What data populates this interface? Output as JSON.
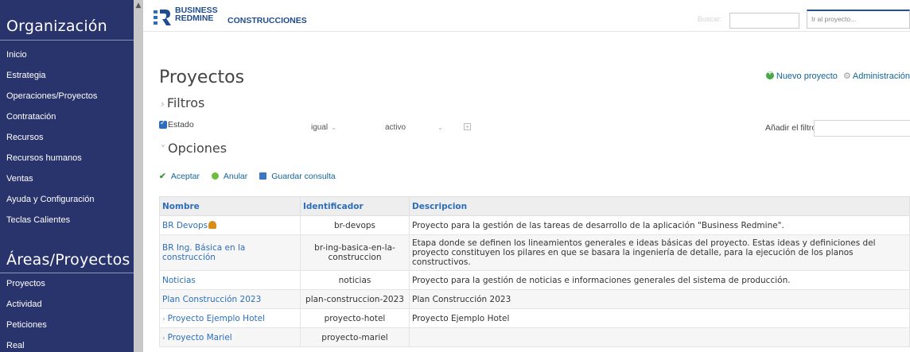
{
  "sidebar": {
    "sections": [
      "Organización",
      "Áreas/Proyectos"
    ],
    "org_items": [
      "Inicio",
      "Estrategia",
      "Operaciones/Proyectos",
      "Contratación",
      "Recursos",
      "Recursos humanos",
      "Ventas",
      "Ayuda y Configuración",
      "Teclas Calientes"
    ],
    "area_items": [
      "Proyectos",
      "Actividad",
      "Peticiones",
      "Real"
    ]
  },
  "header": {
    "logo_line1": "BUSINESS",
    "logo_line2": "REDMINE",
    "brand": "CONSTRUCCIONES",
    "search_label": "Buscar:",
    "jump_placeholder": "Ir al proyecto..."
  },
  "main": {
    "title": "Proyectos",
    "new_project": "Nuevo proyecto",
    "admin": "Administración",
    "filters_label": "Filtros",
    "filter": {
      "label": "Estado",
      "operator": "igual",
      "value": "activo"
    },
    "add_filter_label": "Añadir el filtro",
    "options_label": "Opciones",
    "apply": "Aceptar",
    "clear": "Anular",
    "save_query": "Guardar consulta"
  },
  "table": {
    "headers": [
      "Nombre",
      "Identificador",
      "Descripcion"
    ],
    "rows": [
      {
        "name": "BR Devops",
        "ident": "br-devops",
        "desc": "Proyecto para la gestión de las tareas de desarrollo de la aplicación \"Business Redmine\"."
      },
      {
        "name": "BR Ing. Básica en la construcción",
        "ident": "br-ing-basica-en-la-construccion",
        "desc": "Etapa donde se definen los lineamientos generales e ideas básicas del proyecto. Estas ideas y definiciones del proyecto constituyen los pilares en que se basara la ingeniería de detalle, para la ejecución de los planos constructivos."
      },
      {
        "name": "Noticias",
        "ident": "noticias",
        "desc": "Proyecto para la gestión de noticias e informaciones generales del sistema de producción."
      },
      {
        "name": "Plan Construcción 2023",
        "ident": "plan-construccion-2023",
        "desc": "Plan Construcción 2023"
      },
      {
        "name": "Proyecto Ejemplo Hotel",
        "ident": "proyecto-hotel",
        "desc": "Proyecto Ejemplo Hotel"
      },
      {
        "name": "Proyecto Mariel",
        "ident": "proyecto-mariel",
        "desc": ""
      }
    ]
  }
}
